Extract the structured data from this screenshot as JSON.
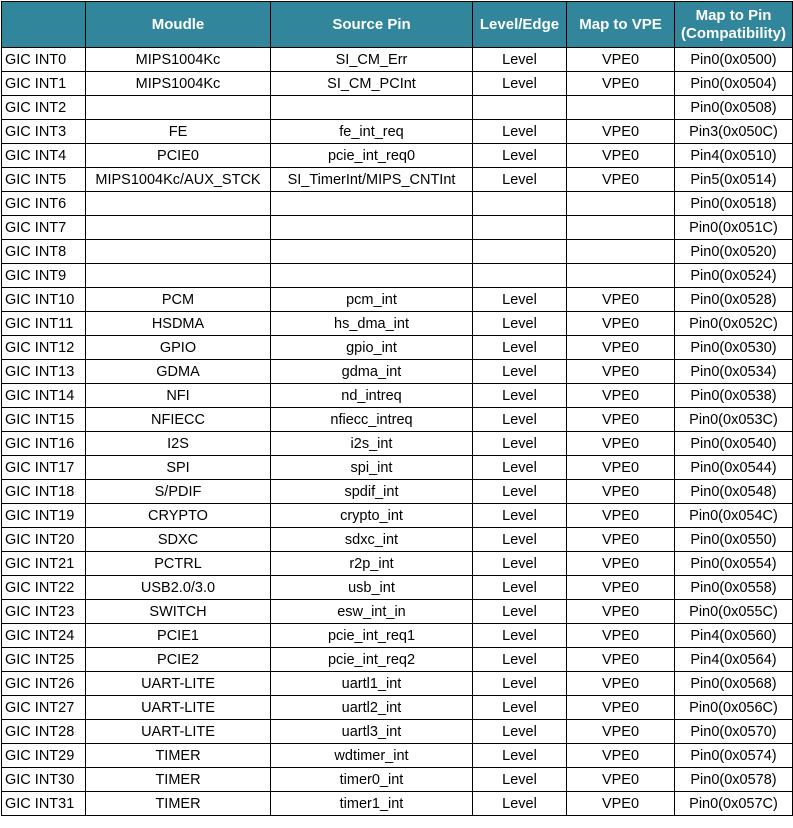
{
  "headers": {
    "int": "",
    "module": "Moudle",
    "source_pin": "Source Pin",
    "level_edge": "Level/Edge",
    "map_vpe": "Map to VPE",
    "map_pin_line1": "Map to Pin",
    "map_pin_line2": "(Compatibility)"
  },
  "rows": [
    {
      "int": "GIC INT0",
      "module": "MIPS1004Kc",
      "source_pin": "SI_CM_Err",
      "level": "Level",
      "vpe": "VPE0",
      "pin": "Pin0(0x0500)"
    },
    {
      "int": "GIC INT1",
      "module": "MIPS1004Kc",
      "source_pin": "SI_CM_PCInt",
      "level": "Level",
      "vpe": "VPE0",
      "pin": "Pin0(0x0504)"
    },
    {
      "int": "GIC INT2",
      "module": "",
      "source_pin": "",
      "level": "",
      "vpe": "",
      "pin": "Pin0(0x0508)"
    },
    {
      "int": "GIC INT3",
      "module": "FE",
      "source_pin": "fe_int_req",
      "level": "Level",
      "vpe": "VPE0",
      "pin": "Pin3(0x050C)"
    },
    {
      "int": "GIC INT4",
      "module": "PCIE0",
      "source_pin": "pcie_int_req0",
      "level": "Level",
      "vpe": "VPE0",
      "pin": "Pin4(0x0510)"
    },
    {
      "int": "GIC INT5",
      "module": "MIPS1004Kc/AUX_STCK",
      "source_pin": "SI_TimerInt/MIPS_CNTInt",
      "level": "Level",
      "vpe": "VPE0",
      "pin": "Pin5(0x0514)"
    },
    {
      "int": "GIC INT6",
      "module": "",
      "source_pin": "",
      "level": "",
      "vpe": "",
      "pin": "Pin0(0x0518)"
    },
    {
      "int": "GIC INT7",
      "module": "",
      "source_pin": "",
      "level": "",
      "vpe": "",
      "pin": "Pin0(0x051C)"
    },
    {
      "int": "GIC INT8",
      "module": "",
      "source_pin": "",
      "level": "",
      "vpe": "",
      "pin": "Pin0(0x0520)"
    },
    {
      "int": "GIC INT9",
      "module": "",
      "source_pin": "",
      "level": "",
      "vpe": "",
      "pin": "Pin0(0x0524)"
    },
    {
      "int": "GIC INT10",
      "module": "PCM",
      "source_pin": "pcm_int",
      "level": "Level",
      "vpe": "VPE0",
      "pin": "Pin0(0x0528)"
    },
    {
      "int": "GIC INT11",
      "module": "HSDMA",
      "source_pin": "hs_dma_int",
      "level": "Level",
      "vpe": "VPE0",
      "pin": "Pin0(0x052C)"
    },
    {
      "int": "GIC INT12",
      "module": "GPIO",
      "source_pin": "gpio_int",
      "level": "Level",
      "vpe": "VPE0",
      "pin": "Pin0(0x0530)"
    },
    {
      "int": "GIC INT13",
      "module": "GDMA",
      "source_pin": "gdma_int",
      "level": "Level",
      "vpe": "VPE0",
      "pin": "Pin0(0x0534)"
    },
    {
      "int": "GIC INT14",
      "module": "NFI",
      "source_pin": "nd_intreq",
      "level": "Level",
      "vpe": "VPE0",
      "pin": "Pin0(0x0538)"
    },
    {
      "int": "GIC INT15",
      "module": "NFIECC",
      "source_pin": "nfiecc_intreq",
      "level": "Level",
      "vpe": "VPE0",
      "pin": "Pin0(0x053C)"
    },
    {
      "int": "GIC INT16",
      "module": "I2S",
      "source_pin": "i2s_int",
      "level": "Level",
      "vpe": "VPE0",
      "pin": "Pin0(0x0540)"
    },
    {
      "int": "GIC INT17",
      "module": "SPI",
      "source_pin": "spi_int",
      "level": "Level",
      "vpe": "VPE0",
      "pin": "Pin0(0x0544)"
    },
    {
      "int": "GIC INT18",
      "module": "S/PDIF",
      "source_pin": "spdif_int",
      "level": "Level",
      "vpe": "VPE0",
      "pin": "Pin0(0x0548)"
    },
    {
      "int": "GIC INT19",
      "module": "CRYPTO",
      "source_pin": "crypto_int",
      "level": "Level",
      "vpe": "VPE0",
      "pin": "Pin0(0x054C)"
    },
    {
      "int": "GIC INT20",
      "module": "SDXC",
      "source_pin": "sdxc_int",
      "level": "Level",
      "vpe": "VPE0",
      "pin": "Pin0(0x0550)"
    },
    {
      "int": "GIC INT21",
      "module": "PCTRL",
      "source_pin": "r2p_int",
      "level": "Level",
      "vpe": "VPE0",
      "pin": "Pin0(0x0554)"
    },
    {
      "int": "GIC INT22",
      "module": "USB2.0/3.0",
      "source_pin": "usb_int",
      "level": "Level",
      "vpe": "VPE0",
      "pin": "Pin0(0x0558)"
    },
    {
      "int": "GIC INT23",
      "module": "SWITCH",
      "source_pin": "esw_int_in",
      "level": "Level",
      "vpe": "VPE0",
      "pin": "Pin0(0x055C)"
    },
    {
      "int": "GIC INT24",
      "module": "PCIE1",
      "source_pin": "pcie_int_req1",
      "level": "Level",
      "vpe": "VPE0",
      "pin": "Pin4(0x0560)"
    },
    {
      "int": "GIC INT25",
      "module": "PCIE2",
      "source_pin": "pcie_int_req2",
      "level": "Level",
      "vpe": "VPE0",
      "pin": "Pin4(0x0564)"
    },
    {
      "int": "GIC INT26",
      "module": "UART-LITE",
      "source_pin": "uartl1_int",
      "level": "Level",
      "vpe": "VPE0",
      "pin": "Pin0(0x0568)"
    },
    {
      "int": "GIC INT27",
      "module": "UART-LITE",
      "source_pin": "uartl2_int",
      "level": "Level",
      "vpe": "VPE0",
      "pin": "Pin0(0x056C)"
    },
    {
      "int": "GIC INT28",
      "module": "UART-LITE",
      "source_pin": "uartl3_int",
      "level": "Level",
      "vpe": "VPE0",
      "pin": "Pin0(0x0570)"
    },
    {
      "int": "GIC INT29",
      "module": "TIMER",
      "source_pin": "wdtimer_int",
      "level": "Level",
      "vpe": "VPE0",
      "pin": "Pin0(0x0574)"
    },
    {
      "int": "GIC INT30",
      "module": "TIMER",
      "source_pin": "timer0_int",
      "level": "Level",
      "vpe": "VPE0",
      "pin": "Pin0(0x0578)"
    },
    {
      "int": "GIC INT31",
      "module": "TIMER",
      "source_pin": "timer1_int",
      "level": "Level",
      "vpe": "VPE0",
      "pin": "Pin0(0x057C)"
    }
  ],
  "colors": {
    "header_bg": "#31869b",
    "header_text": "#ffffff",
    "border": "#000000"
  }
}
